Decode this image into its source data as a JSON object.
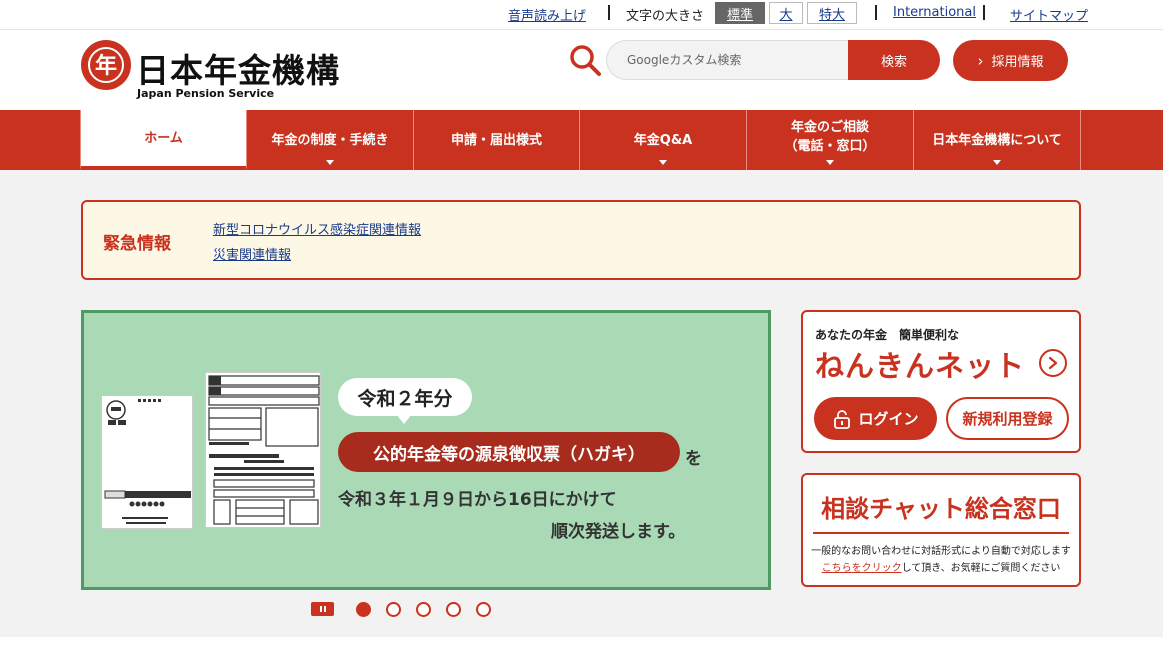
{
  "utility": {
    "read_aloud": "音声読み上げ",
    "font_size_label": "文字の大きさ",
    "size_standard": "標準",
    "size_large": "大",
    "size_xlarge": "特大",
    "international": "International",
    "sitemap": "サイトマップ"
  },
  "header": {
    "logo_title": "日本年金機構",
    "logo_subtitle": "Japan Pension Service",
    "logo_mark_char": "年",
    "search_placeholder": "Googleカスタム検索",
    "search_button": "検索",
    "recruit_label": "採用情報",
    "recruit_chevron": "›"
  },
  "nav": {
    "home": "ホーム",
    "system": "年金の制度・手続き",
    "forms": "申請・届出様式",
    "qa": "年金Q&A",
    "consult_line1": "年金のご相談",
    "consult_line2": "（電話・窓口）",
    "about": "日本年金機構について"
  },
  "emergency": {
    "title": "緊急情報",
    "links": [
      "新型コロナウイルス感染症関連情報",
      "災害関連情報"
    ]
  },
  "banner": {
    "bubble": "令和２年分",
    "pill": "公的年金等の源泉徴収票（ハガキ）",
    "particle": "を",
    "line1": "令和３年１月９日から16日にかけて",
    "line2": "順次発送します。"
  },
  "slider": {
    "dot_count": 5,
    "active_index": 0
  },
  "nenkin_net": {
    "subtitle": "あなたの年金　簡単便利な",
    "title": "ねんきんネット",
    "login": "ログイン",
    "register": "新規利用登録"
  },
  "chat": {
    "title": "相談チャット総合窓口",
    "desc": "一般的なお問い合わせに対話形式により自動で対応します",
    "link": "こちらをクリック",
    "desc2": "して頂き、お気軽にご質問ください"
  },
  "colors": {
    "brand_red": "#c8321e",
    "banner_green": "#a9d9b5",
    "emergency_bg": "#fdf8e6"
  }
}
